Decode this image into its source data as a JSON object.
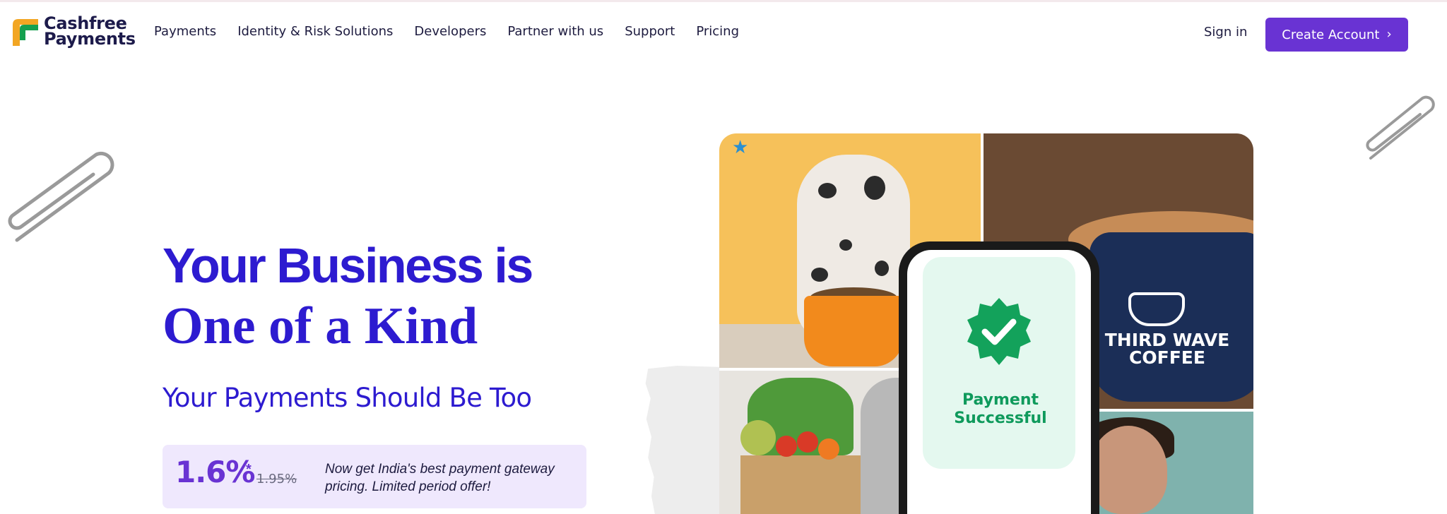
{
  "brand": {
    "name_line1": "Cashfree",
    "name_line2": "Payments"
  },
  "nav": [
    {
      "label": "Payments"
    },
    {
      "label": "Identity & Risk Solutions"
    },
    {
      "label": "Developers"
    },
    {
      "label": "Partner with us"
    },
    {
      "label": "Support"
    },
    {
      "label": "Pricing"
    }
  ],
  "header": {
    "sign_in": "Sign in",
    "create_account": "Create Account"
  },
  "hero": {
    "title_line1": "Your Business is",
    "title_line2": "One of a Kind",
    "subtitle": "Your Payments Should Be Too"
  },
  "promo": {
    "rate": "1.6%",
    "rate_note": "*",
    "old_rate": "1.95%",
    "text": "Now get India's best payment gateway pricing. Limited period offer!"
  },
  "collage": {
    "coffee_brand": "THIRD WAVE COFFEE",
    "phone_status": "Payment Successful"
  },
  "colors": {
    "accent": "#6933d3",
    "headline": "#2d1bd0",
    "success": "#0f9a5c"
  },
  "icons": [
    "cashfree-logo-icon",
    "chevron-right-icon",
    "paperclip-icon",
    "check-badge-icon",
    "star-icon"
  ]
}
